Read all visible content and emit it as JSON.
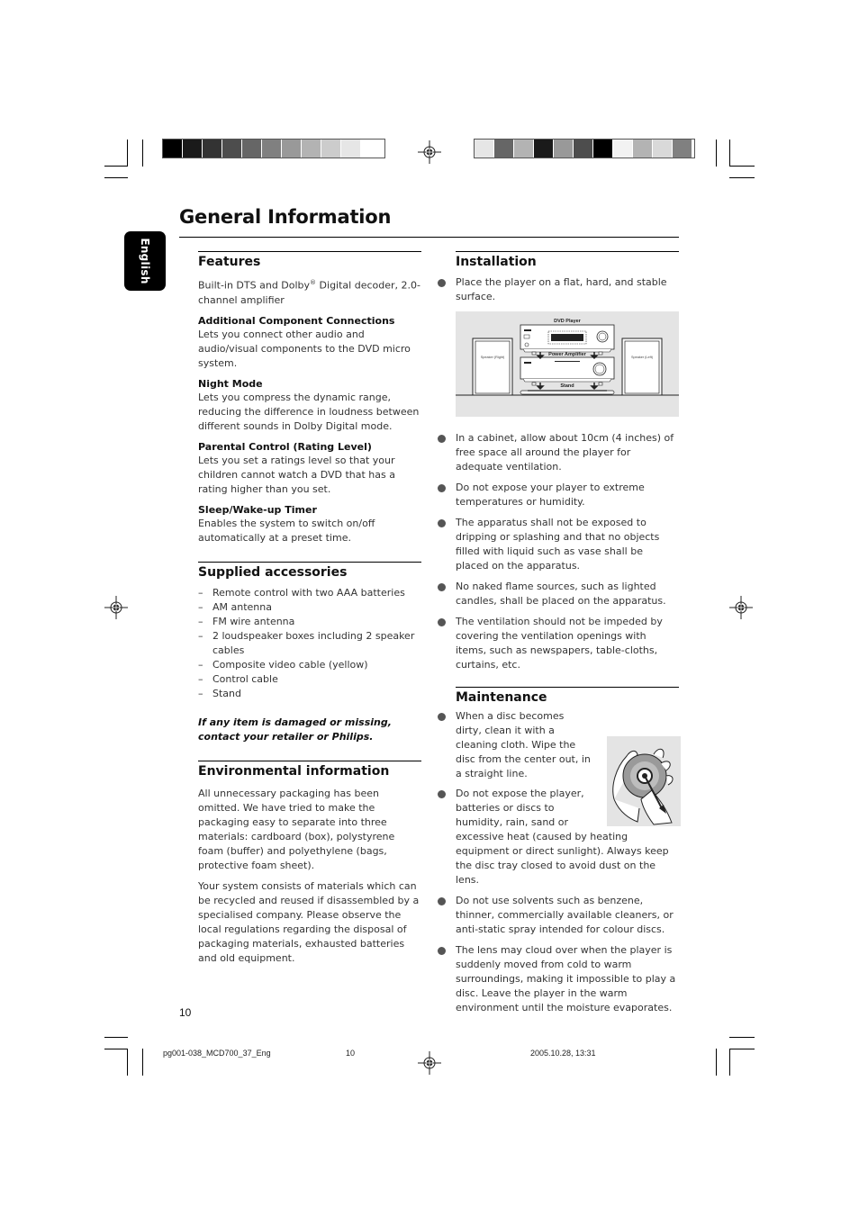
{
  "page": {
    "title": "General Information",
    "language_tab": "English",
    "page_number": "10"
  },
  "print_marks": {
    "left_bar_colors": [
      "#000000",
      "#1a1a1a",
      "#333333",
      "#4d4d4d",
      "#666666",
      "#808080",
      "#999999",
      "#b3b3b3",
      "#cccccc",
      "#e6e6e6",
      "#ffffff"
    ],
    "right_bar_colors": [
      "#e6e6e6",
      "#666666",
      "#b3b3b3",
      "#1a1a1a",
      "#999999",
      "#4d4d4d",
      "#000000",
      "#f2f2f2",
      "#b3b3b3",
      "#d9d9d9",
      "#808080"
    ]
  },
  "features": {
    "title": "Features",
    "intro": "Built-in DTS and Dolby® Digital decoder, 2.0-channel amplifier",
    "items": [
      {
        "heading": "Additional Component Connections",
        "text": "Lets you connect other audio and audio/visual components to the DVD micro system."
      },
      {
        "heading": "Night Mode",
        "text": "Lets you compress the dynamic range, reducing the difference in loudness between different sounds in Dolby Digital mode."
      },
      {
        "heading": "Parental Control (Rating Level)",
        "text": "Lets you set a ratings level so that your children cannot watch a DVD that has a rating higher than you set."
      },
      {
        "heading": "Sleep/Wake-up Timer",
        "text": "Enables the system to switch on/off automatically at a preset time."
      }
    ]
  },
  "accessories": {
    "title": "Supplied accessories",
    "items": [
      "Remote control with two AAA batteries",
      "AM antenna",
      "FM wire antenna",
      "2 loudspeaker boxes including 2 speaker cables",
      "Composite video cable (yellow)",
      "Control cable",
      "Stand"
    ],
    "note": "If any item is damaged or missing, contact your retailer or Philips."
  },
  "environment": {
    "title": "Environmental information",
    "paragraphs": [
      "All unnecessary packaging has been omitted. We have tried to make the packaging easy to separate into three materials: cardboard (box), polystyrene foam (buffer) and polyethylene (bags, protective foam sheet).",
      "Your system consists of materials which can be recycled and reused if disassembled by a specialised company. Please observe the local regulations regarding the disposal of packaging materials, exhausted batteries and old equipment."
    ]
  },
  "installation": {
    "title": "Installation",
    "first_item": "Place the player on a flat, hard, and stable surface.",
    "figure": {
      "dvd_player": "DVD Player",
      "power_amplifier": "Power Amplifier",
      "stand": "Stand",
      "speaker_right": "Speaker (Right)",
      "speaker_left": "Speaker (Left)"
    },
    "items": [
      "In a cabinet, allow about 10cm (4 inches) of free space all around the player for adequate ventilation.",
      "Do not expose your player to extreme temperatures or humidity.",
      "The apparatus shall not be exposed to dripping or splashing and that no objects  filled with liquid such as vase shall be placed on the apparatus.",
      "No naked flame sources, such as lighted candles, shall be placed on the apparatus.",
      "The ventilation should not be impeded by covering the ventilation openings with items, such as newspapers, table-cloths, curtains, etc."
    ]
  },
  "maintenance": {
    "title": "Maintenance",
    "items": [
      "When a disc becomes dirty, clean it with a cleaning cloth. Wipe the disc from the center out, in a straight line.",
      "Do not expose the player, batteries or discs to humidity, rain, sand or excessive heat (caused by heating equipment or direct sunlight). Always keep the disc tray closed to avoid dust on the lens.",
      "Do not use solvents such as benzene, thinner, commercially available cleaners, or anti-static spray intended for colour discs.",
      "The lens may cloud over when the player is suddenly moved from cold to warm surroundings, making it impossible to play a disc. Leave the player in the warm environment until the moisture evaporates."
    ]
  },
  "footer": {
    "file_name": "pg001-038_MCD700_37_Eng",
    "page": "10",
    "timestamp": "2005.10.28, 13:31"
  }
}
